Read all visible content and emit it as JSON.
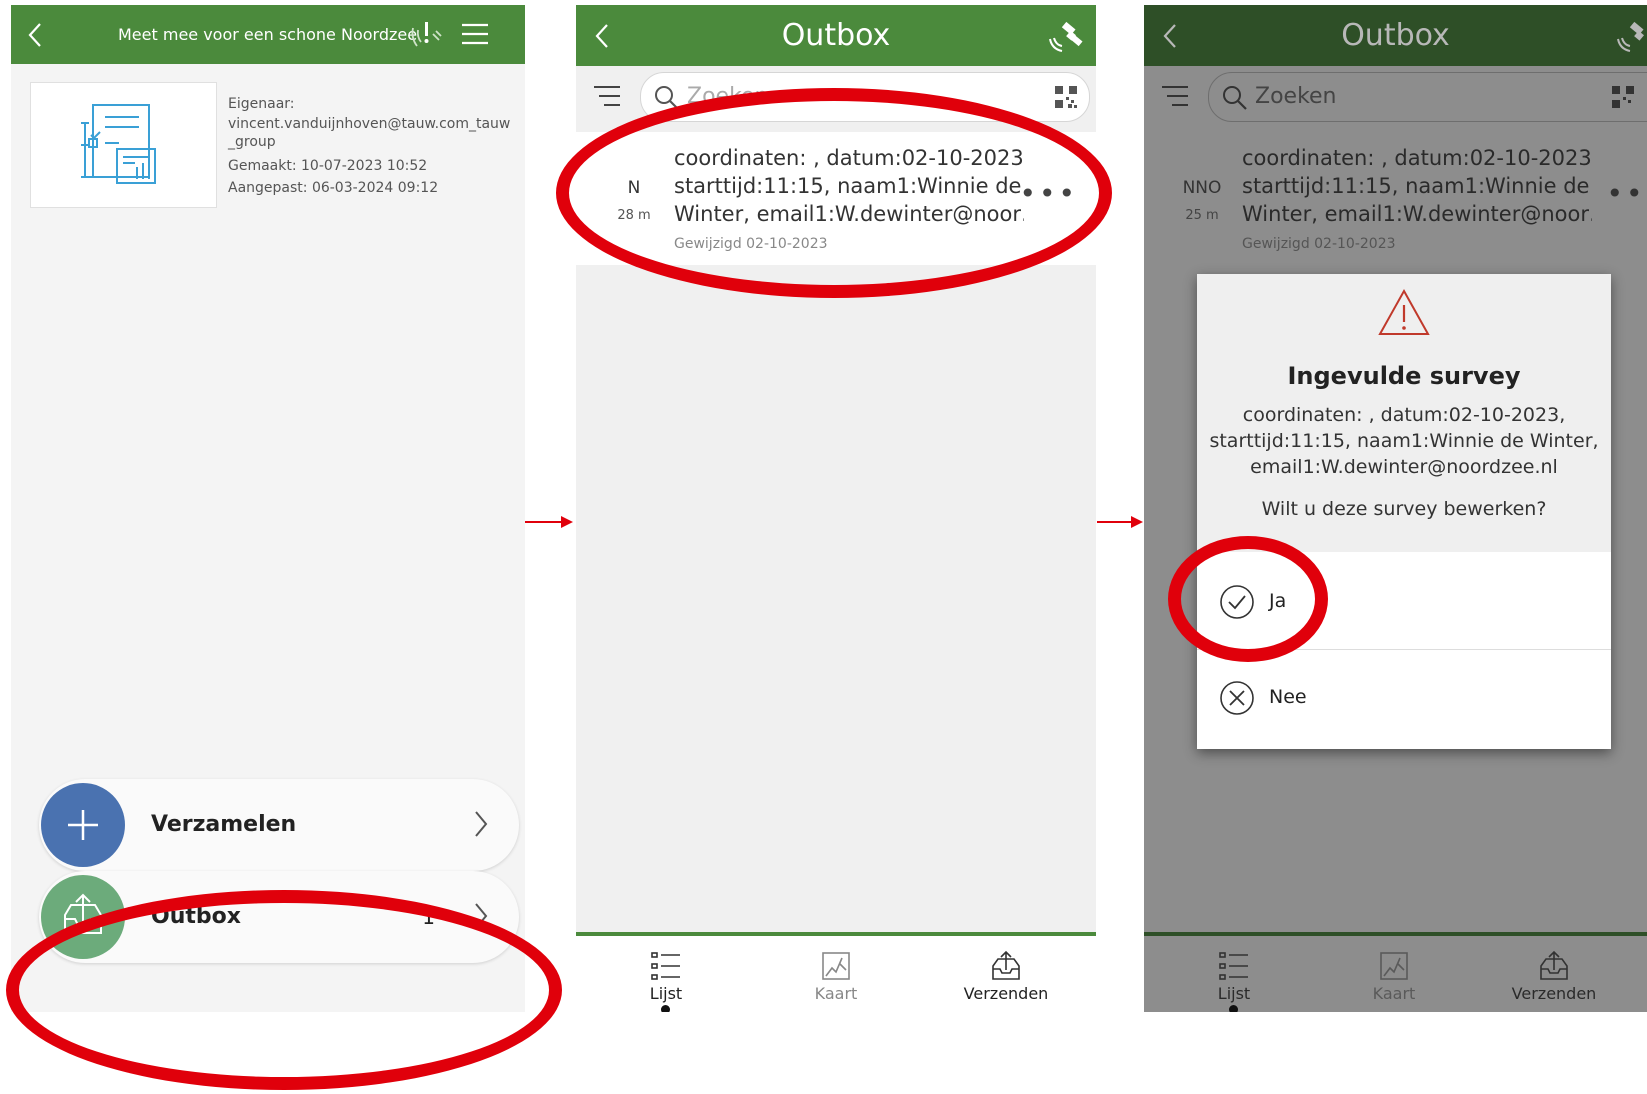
{
  "panel1": {
    "title": "Meet mee voor een schone Noordzee",
    "owner_label": "Eigenaar:",
    "owner_value": "vincent.vanduijnhoven@tauw.com_tauw_group",
    "created": "Gemaakt: 10-07-2023 10:52",
    "modified": "Aangepast: 06-03-2024 09:12",
    "collect_label": "Verzamelen",
    "outbox_label": "Outbox",
    "outbox_count": "1",
    "collect_color": "#4a72b0",
    "outbox_color": "#6cab7b"
  },
  "panel2": {
    "title": "Outbox",
    "search_placeholder": "Zoeken",
    "record": {
      "direction": "N",
      "distance": "28 m",
      "line1": "coordinaten: , datum:02-10-2023,",
      "line2": "starttijd:11:15, naam1:Winnie de",
      "line3": "Winter, email1:W.dewinter@noor…",
      "modified": "Gewijzigd 02-10-2023"
    },
    "tabs": {
      "list": "Lijst",
      "map": "Kaart",
      "send": "Verzenden"
    }
  },
  "panel3": {
    "title": "Outbox",
    "search_placeholder": "Zoeken",
    "record": {
      "direction": "NNO",
      "distance": "25 m",
      "line1": "coordinaten: , datum:02-10-2023,",
      "line2": "starttijd:11:15, naam1:Winnie de",
      "line3": "Winter, email1:W.dewinter@noor…",
      "modified": "Gewijzigd 02-10-2023"
    },
    "dialog": {
      "title": "Ingevulde survey",
      "msg1": "coordinaten: , datum:02-10-2023,",
      "msg2": "starttijd:11:15, naam1:Winnie de Winter,",
      "msg3": "email1:W.dewinter@noordzee.nl",
      "question": "Wilt u deze survey bewerken?",
      "yes": "Ja",
      "no": "Nee"
    },
    "tabs": {
      "list": "Lijst",
      "map": "Kaart",
      "send": "Verzenden"
    }
  },
  "colors": {
    "header_green": "#4b8a3c",
    "highlight_red": "#e0000b"
  }
}
